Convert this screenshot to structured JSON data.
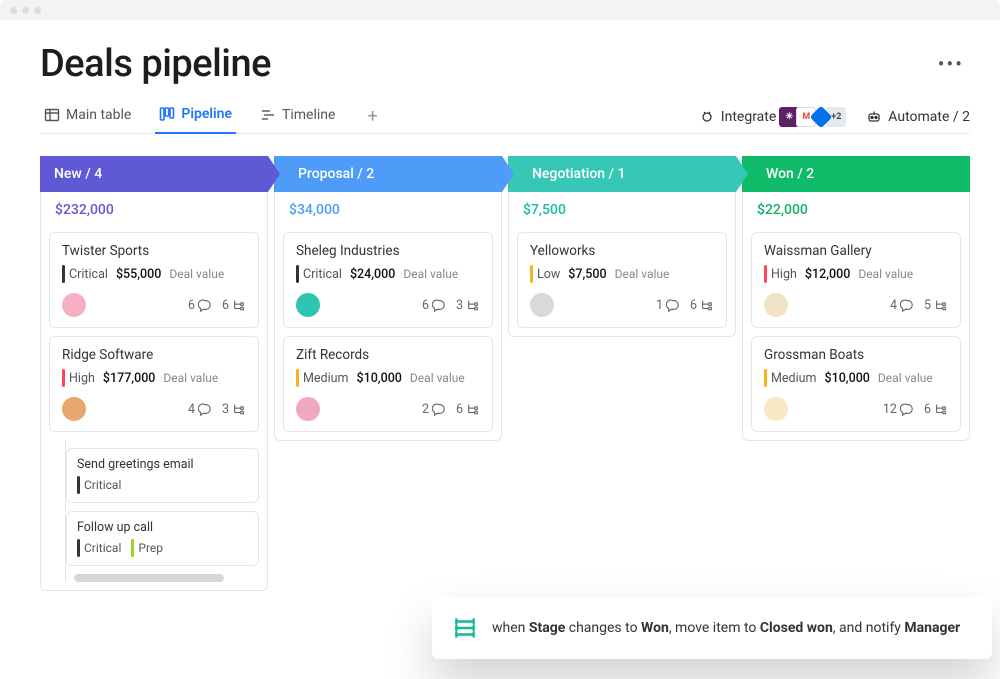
{
  "page": {
    "title": "Deals pipeline"
  },
  "tabs": {
    "main_table": "Main table",
    "pipeline": "Pipeline",
    "timeline": "Timeline"
  },
  "toolbar": {
    "integrate": "Integrate",
    "integrate_more": "+2",
    "automate": "Automate / 2"
  },
  "deal_value_label": "Deal value",
  "columns": [
    {
      "title": "New / 4",
      "total": "$232,000",
      "totalClass": "c0t",
      "cards": [
        {
          "title": "Twister Sports",
          "priority": "Critical",
          "priorityClass": "critical",
          "amount": "$55,000",
          "comments": "6",
          "subs": "6",
          "avatar": "#f6b0c4"
        },
        {
          "title": "Ridge Software",
          "priority": "High",
          "priorityClass": "high",
          "amount": "$177,000",
          "comments": "4",
          "subs": "3",
          "avatar": "#e7a86d"
        }
      ],
      "subitems": [
        {
          "title": "Send greetings email",
          "tags": [
            {
              "label": "Critical",
              "cls": "critical"
            }
          ]
        },
        {
          "title": "Follow up call",
          "tags": [
            {
              "label": "Critical",
              "cls": "critical"
            },
            {
              "label": "Prep",
              "cls": "prep"
            }
          ]
        }
      ]
    },
    {
      "title": "Proposal / 2",
      "total": "$34,000",
      "totalClass": "c1t",
      "cards": [
        {
          "title": "Sheleg Industries",
          "priority": "Critical",
          "priorityClass": "critical",
          "amount": "$24,000",
          "comments": "6",
          "subs": "3",
          "avatar": "#2fc6b0"
        },
        {
          "title": "Zift Records",
          "priority": "Medium",
          "priorityClass": "medium",
          "amount": "$10,000",
          "comments": "2",
          "subs": "6",
          "avatar": "#f2a7c0"
        }
      ]
    },
    {
      "title": "Negotiation / 1",
      "total": "$7,500",
      "totalClass": "c2t",
      "cards": [
        {
          "title": "Yelloworks",
          "priority": "Low",
          "priorityClass": "low",
          "amount": "$7,500",
          "comments": "1",
          "subs": "6",
          "avatar": "#d9d9d9"
        }
      ]
    },
    {
      "title": "Won / 2",
      "total": "$22,000",
      "totalClass": "c3t",
      "cards": [
        {
          "title": "Waissman Gallery",
          "priority": "High",
          "priorityClass": "high",
          "amount": "$12,000",
          "comments": "4",
          "subs": "5",
          "avatar": "#f0e1c7"
        },
        {
          "title": "Grossman Boats",
          "priority": "Medium",
          "priorityClass": "medium",
          "amount": "$10,000",
          "comments": "12",
          "subs": "6",
          "avatar": "#f6e9c3"
        }
      ]
    }
  ],
  "automation": {
    "prefix": "when ",
    "b1": "Stage",
    "mid1": " changes to ",
    "b2": "Won",
    "mid2": ", move item to ",
    "b3": "Closed won",
    "mid3": ", and notify ",
    "b4": "Manager"
  }
}
